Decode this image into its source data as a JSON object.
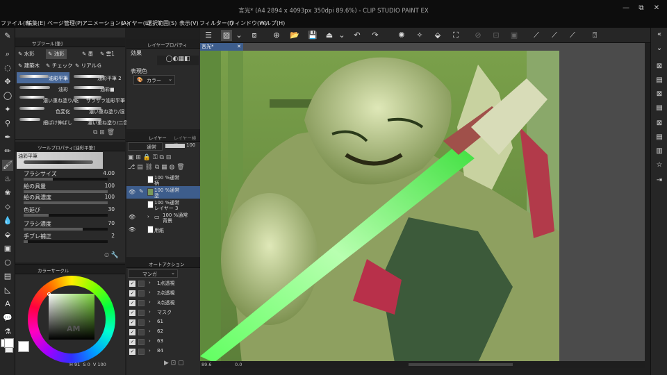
{
  "window": {
    "title": "言光* (A4 2894 x 4093px 350dpi 89.6%) - CLIP STUDIO PAINT EX"
  },
  "menu": [
    "ファイル(F)",
    "編集(E)",
    "ページ管理(P)",
    "アニメーション(A)",
    "レイヤー(L)",
    "選択範囲(S)",
    "表示(V)",
    "フィルター(I)",
    "ウィンドウ(W)",
    "ヘルプ(H)"
  ],
  "subtool": {
    "header": "サブツール[筆]",
    "tabs": [
      "水彩",
      "油彩",
      "墨",
      "雲1",
      "建築木",
      "チェック",
      "リアルＧ"
    ],
    "brushes": [
      "油彩平筆",
      "油彩平筆 2",
      "油彩",
      "油彩■",
      "濃い重ね塗り/乾",
      "ザラザラ油彩平筆",
      "色変化",
      "濃い重ね塗り/湿",
      "細ばけ伸ばし",
      "濃い重ね塗り/二色"
    ]
  },
  "toolproperty": {
    "header": "ツールプロパティ[油彩平筆]",
    "brush_name": "油彩平筆",
    "props": [
      {
        "label": "ブラシサイズ",
        "value": "4.00",
        "fill": 0.35
      },
      {
        "label": "絵の具量",
        "value": "100",
        "fill": 1.0
      },
      {
        "label": "絵の具濃度",
        "value": "100",
        "fill": 1.0
      },
      {
        "label": "色延び",
        "value": "30",
        "fill": 0.3
      },
      {
        "label": "ブラシ濃度",
        "value": "70",
        "fill": 0.7
      },
      {
        "label": "手ブレ補正",
        "value": "2",
        "fill": 0.05
      }
    ]
  },
  "colorcircle": {
    "header": "カラーサークル",
    "readout_h": "91",
    "readout_s": "0",
    "readout_v": "100",
    "main_color": "#ffffff",
    "sub_color": "#e8e8e8"
  },
  "effect": {
    "tab": "レイヤープロパティ",
    "title": "効果",
    "expr_label": "表現色",
    "expr_value": "カラー"
  },
  "layers": {
    "tab1": "レイヤー",
    "tab2": "レイヤー検索",
    "blend": "通常",
    "opacity": "100",
    "items": [
      {
        "line1": "100 %通常",
        "line2": "柄"
      },
      {
        "line1": "100 %通常",
        "line2": "塗"
      },
      {
        "line1": "100 %通常",
        "line2": "レイヤー 3"
      },
      {
        "line1": "100 %通常",
        "line2": "背景"
      },
      {
        "line1": "",
        "line2": "用紙"
      }
    ]
  },
  "autoaction": {
    "header": "オートアクション",
    "set": "マンガ",
    "items": [
      "1点透視",
      "2点透視",
      "3点透視",
      "マスク",
      "61",
      "62",
      "63",
      "84"
    ]
  },
  "canvas": {
    "doc_tab": "言光*",
    "zoom": "89.6",
    "angle": "0.0"
  }
}
